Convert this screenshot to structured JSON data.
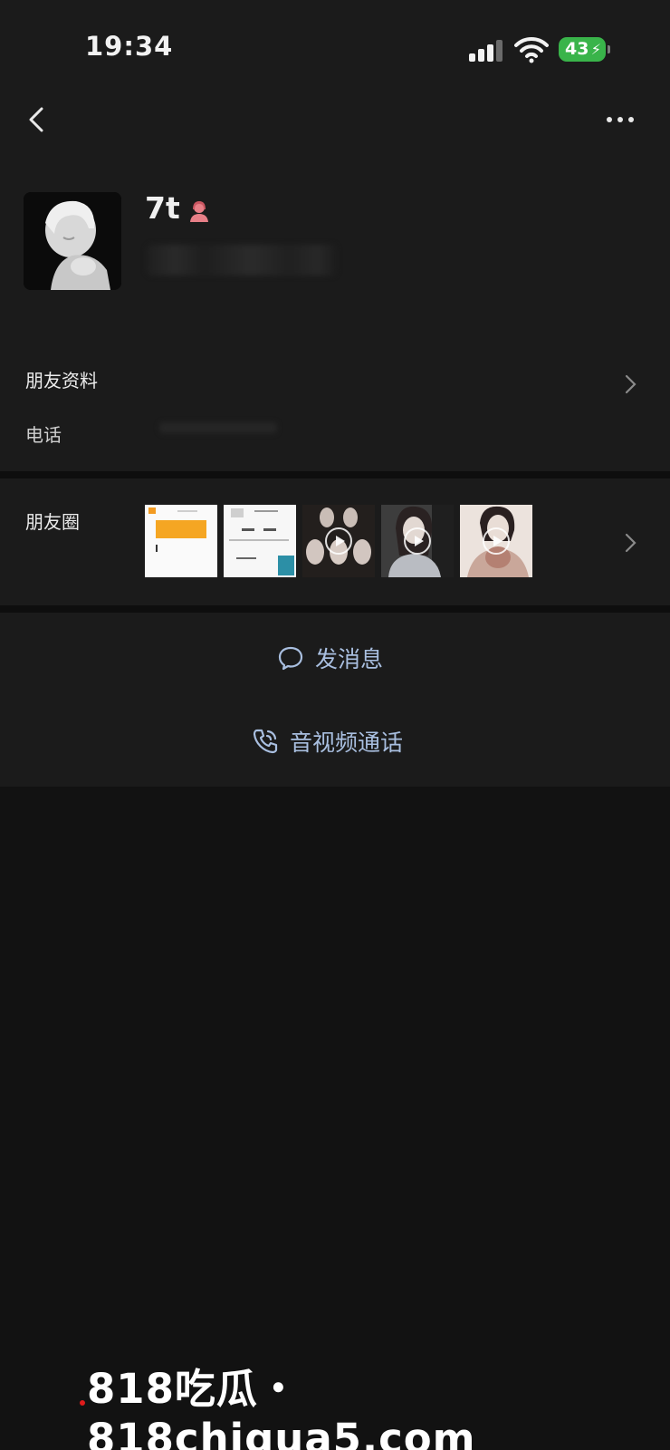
{
  "status_bar": {
    "time": "19:34",
    "battery": "43",
    "signal_bars": 3,
    "wifi": "wifi-icon"
  },
  "nav": {
    "back_icon": "chevron-left-icon",
    "more_icon": "more-dots-icon"
  },
  "profile": {
    "name": "7t",
    "gender_icon": "female-user-icon",
    "avatar_icon": "avatar-image"
  },
  "info": {
    "friend_profile_label": "朋友资料",
    "phone_label": "电话"
  },
  "moments": {
    "label": "朋友圈",
    "thumbs": [
      {
        "kind": "screenshot-orange"
      },
      {
        "kind": "screenshot-doc"
      },
      {
        "kind": "video",
        "play": true
      },
      {
        "kind": "video",
        "play": true
      },
      {
        "kind": "video",
        "play": true
      }
    ]
  },
  "actions": {
    "message_label": "发消息",
    "call_label": "音视频通话",
    "accent_color": "#a9bfe0"
  },
  "watermark": {
    "text": "818吃瓜・818chigua5.com"
  }
}
